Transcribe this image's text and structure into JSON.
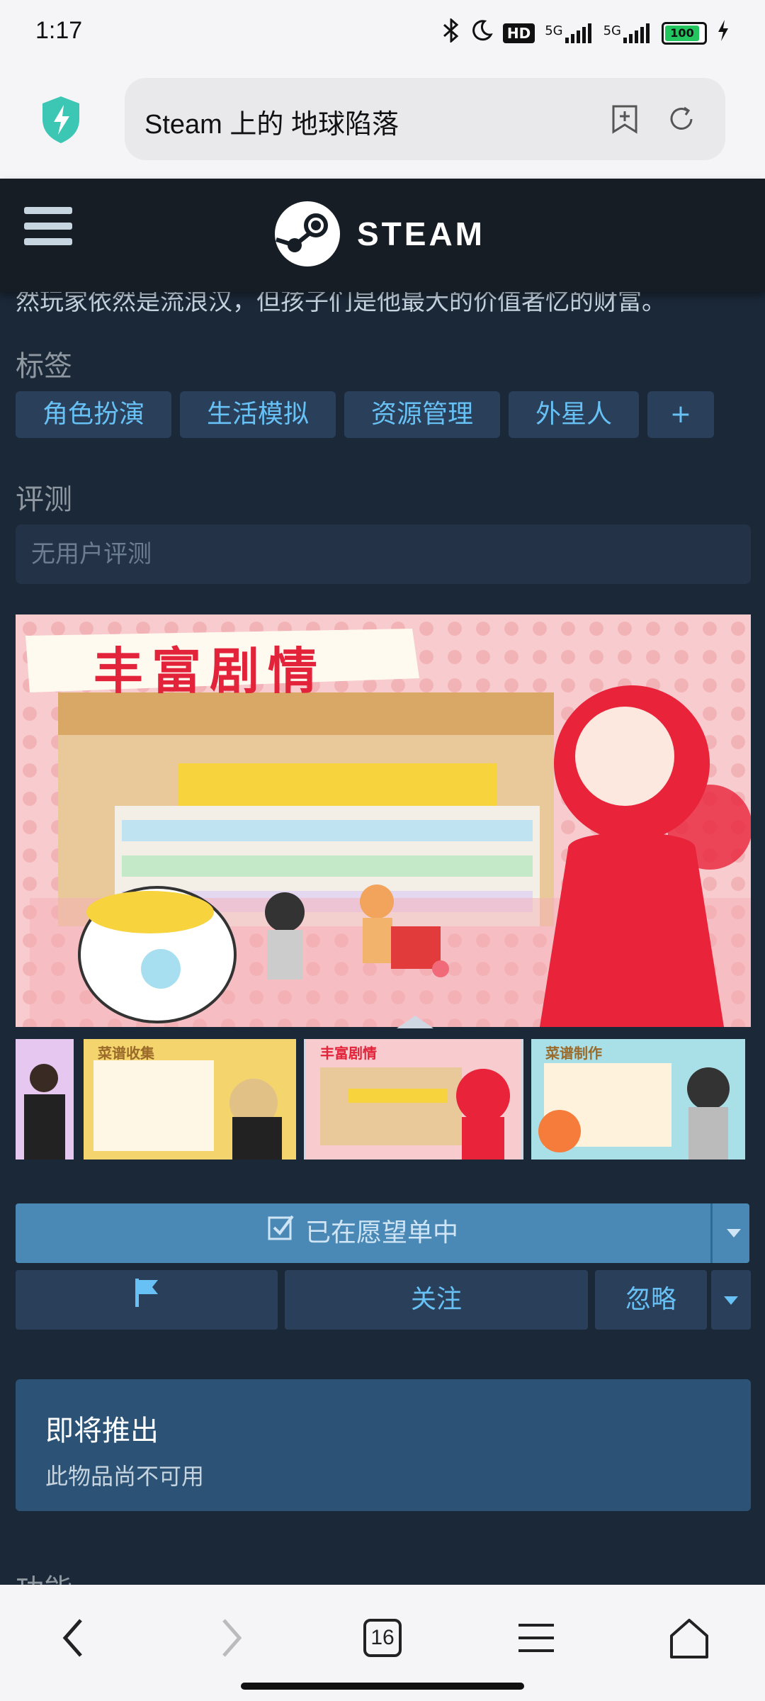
{
  "status_bar": {
    "time": "1:17",
    "icons": [
      "bluetooth-icon",
      "moon-icon",
      "hd-icon",
      "signal-5g-icon",
      "signal-5g-icon",
      "battery-icon",
      "charging-icon"
    ],
    "hd": "HD",
    "net1": "5G",
    "net2": "5G",
    "battery": "100"
  },
  "browser": {
    "url_title": "Steam 上的 地球陷落",
    "tab_count": "16"
  },
  "steam": {
    "logo_text": "STEAM",
    "description_cut": "然玩家依然是流浪汉，但孩子们是他最大的价值者忆的财富。"
  },
  "tags": {
    "heading": "标签",
    "items": [
      "角色扮演",
      "生活模拟",
      "资源管理",
      "外星人",
      "+"
    ]
  },
  "reviews": {
    "heading": "评测",
    "value": "无用户评测"
  },
  "media": {
    "hero_caption": "丰富剧情",
    "thumb_captions": [
      "菜谱收集",
      "丰富剧情",
      "菜谱制作"
    ]
  },
  "actions": {
    "wishlist": "已在愿望单中",
    "follow": "关注",
    "ignore": "忽略"
  },
  "coming_soon": {
    "title": "即将推出",
    "subtitle": "此物品尚不可用"
  },
  "features_heading": "功能",
  "colors": {
    "page_bg": "#1b2838",
    "header_bg": "#171d25",
    "tag_bg": "#2a3f5a",
    "link_blue": "#67c1f5",
    "wishlist_bg": "#4a89b5",
    "coming_bg": "#2c5376"
  }
}
